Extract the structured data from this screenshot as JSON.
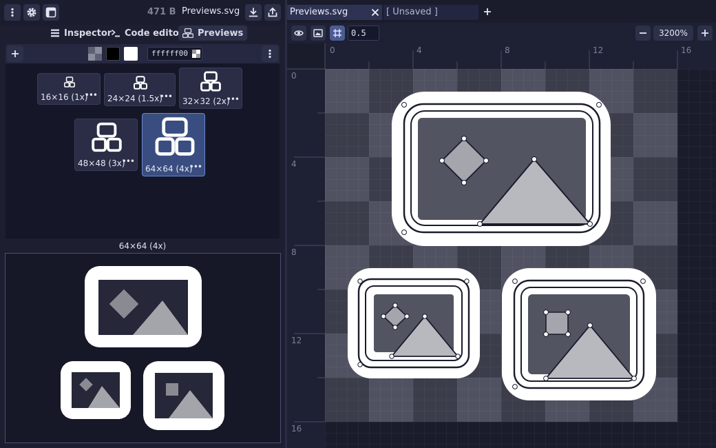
{
  "topbar": {
    "menu_icon": "vertical-dots-icon",
    "settings_icon": "gear-icon",
    "layout_icon": "layout-icon",
    "file_size": "471 B",
    "file_name": "Previews.svg",
    "download_icon": "download-icon",
    "export_icon": "export-icon"
  },
  "panel_tabs": [
    {
      "label": "Inspector",
      "icon": "list-icon"
    },
    {
      "label": "Code editor",
      "icon": "terminal-icon"
    },
    {
      "label": "Previews",
      "icon": "previews-icon"
    }
  ],
  "preview_toolbar": {
    "add_icon": "plus-icon",
    "color_value": "ffffff00",
    "more_icon": "vertical-dots-icon"
  },
  "previews": [
    {
      "label": "16×16 (1x)",
      "selected": false
    },
    {
      "label": "24×24 (1.5x)",
      "selected": false
    },
    {
      "label": "32×32 (2x)",
      "selected": false
    },
    {
      "label": "48×48 (3x)",
      "selected": false
    },
    {
      "label": "64×64 (4x)",
      "selected": true
    }
  ],
  "big_preview": {
    "title": "64×64 (4x)"
  },
  "doc_tabs": [
    {
      "label": "Previews.svg",
      "active": true
    },
    {
      "label": "[ Unsaved ]",
      "active": false
    }
  ],
  "canvas_toolbar": {
    "snap_value": "0.5",
    "zoom": "3200%"
  },
  "ruler": {
    "x_labels": [
      "0",
      "4",
      "8",
      "12",
      "16"
    ],
    "y_labels": [
      "0",
      "4",
      "8",
      "12",
      "16"
    ]
  },
  "colors": {
    "accent": "#4b5c94",
    "selected_card": "#3a4d80",
    "canvas_bg": "#1a1c2c"
  }
}
